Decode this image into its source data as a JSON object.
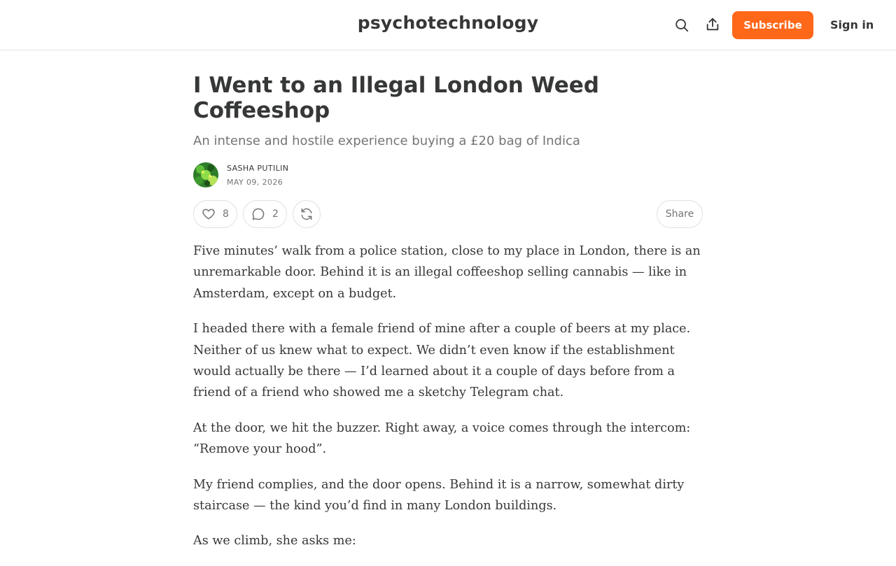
{
  "header": {
    "publication_name": "psychotechnology",
    "subscribe_label": "Subscribe",
    "signin_label": "Sign in",
    "icons": [
      "search-icon",
      "share-icon"
    ],
    "accent_color": "#ff6719"
  },
  "post": {
    "title": "I Went to an Illegal London Weed Coffeeshop",
    "subtitle": "An intense and hostile experience buying a £20 bag of Indica",
    "author": "SASHA PUTILIN",
    "date": "MAY 09, 2026",
    "likes": "8",
    "comments": "2",
    "share_label": "Share",
    "action_icons": [
      "heart-icon",
      "comment-icon",
      "restack-icon"
    ],
    "paragraphs": [
      "Five minutes’ walk from a police station, close to my place in London, there is an unremarkable door. Behind it is an illegal coffeeshop selling cannabis — like in Amsterdam, except on a budget.",
      "I headed there with a female friend of mine after a couple of beers at my place. Neither of us knew what to expect. We didn’t even know if the establishment would actually be there — I’d learned about it a couple of days before from a friend of a friend who showed me a sketchy Telegram chat.",
      "At the door, we hit the buzzer. Right away, a voice comes through the intercom: “Remove your hood”.",
      "My friend complies, and the door opens. Behind it is a narrow, somewhat dirty staircase — the kind you’d find in many London buildings.",
      "As we climb, she asks me:"
    ]
  }
}
